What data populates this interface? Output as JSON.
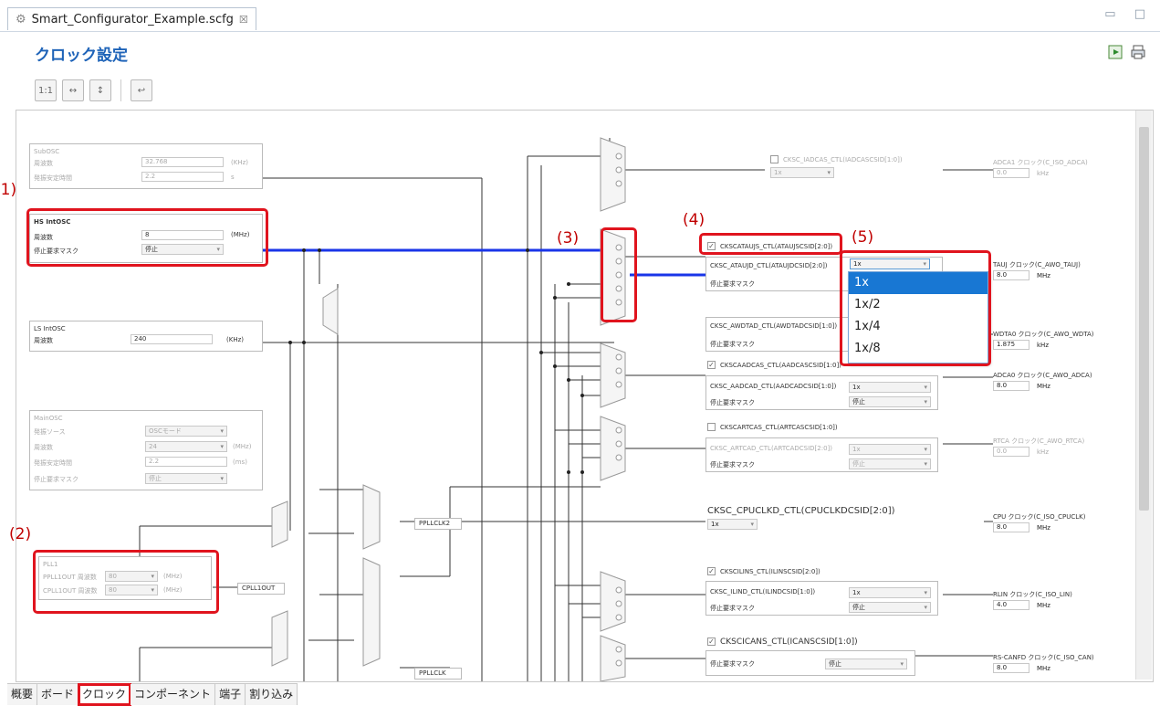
{
  "editor_tab": {
    "title": "Smart_Configurator_Example.scfg",
    "close": "☒"
  },
  "window_controls": "▭ □",
  "page_title": "クロック設定",
  "annotations": [
    "(1)",
    "(2)",
    "(3)",
    "(4)",
    "(5)"
  ],
  "subosc": {
    "title": "SubOSC",
    "freq_label": "周波数",
    "freq_value": "32.768",
    "freq_unit": "(KHz)",
    "stab_label": "発振安定時間",
    "stab_value": "2.2",
    "stab_unit": "s"
  },
  "hs_intosc": {
    "title": "HS IntOSC",
    "freq_label": "周波数",
    "freq_value": "8",
    "freq_unit": "(MHz)",
    "mask_label": "停止要求マスク",
    "mask_value": "停止"
  },
  "ls_intosc": {
    "title": "LS IntOSC",
    "freq_label": "周波数",
    "freq_value": "240",
    "freq_unit": "(KHz)"
  },
  "mainosc": {
    "title": "MainOSC",
    "src_label": "発振ソース",
    "src_value": "OSCモード",
    "freq_label": "周波数",
    "freq_value": "24",
    "freq_unit": "(MHz)",
    "stab_label": "発振安定時間",
    "stab_value": "2.2",
    "stab_unit": "(ms)",
    "mask_label": "停止要求マスク",
    "mask_value": "停止"
  },
  "pll1": {
    "title": "PLL1",
    "out_label": "PPLL1OUT 周波数",
    "out_value": "80",
    "out_unit": "(MHz)",
    "cout_label": "CPLL1OUT 周波数",
    "cout_value": "80",
    "cout_unit": "(MHz)"
  },
  "signals": {
    "cpll1out": "CPLL1OUT",
    "ppllclk2": "PPLLCLK2",
    "ppllclk": "PPLLCLK"
  },
  "adca1": {
    "cb": "CKSC_IADCAS_CTL(IADCASCSID[1:0])",
    "sel": "1x",
    "out_label": "ADCA1 クロック(C_ISO_ADCA)",
    "out_value": "0.0",
    "unit": "kHz"
  },
  "atauj": {
    "cb": "CKSCATAUJS_CTL(ATAUJSCSID[2:0])",
    "div_label": "CKSC_ATAUJD_CTL(ATAUJDCSID[2:0])",
    "div_value": "1x",
    "mask_label": "停止要求マスク",
    "out_label": "TAUJ クロック(C_AWO_TAUJ)",
    "out_value": "8.0",
    "unit": "MHz"
  },
  "dropdown": {
    "options": [
      "1x",
      "1x/2",
      "1x/4",
      "1x/8"
    ]
  },
  "awdta": {
    "div_label": "CKSC_AWDTAD_CTL(AWDTADCSID[1:0])",
    "mask_label": "停止要求マスク",
    "out_label": "WDTA0 クロック(C_AWO_WDTA)",
    "out_value": "1.875",
    "unit": "kHz"
  },
  "aadca": {
    "cb": "CKSCAADCAS_CTL(AADCASCSID[1:0])",
    "div_label": "CKSC_AADCAD_CTL(AADCADCSID[1:0])",
    "div_value": "1x",
    "mask_label": "停止要求マスク",
    "mask_value": "停止",
    "out_label": "ADCA0 クロック(C_AWO_ADCA)",
    "out_value": "8.0",
    "unit": "MHz"
  },
  "artca": {
    "cb": "CKSCARTCAS_CTL(ARTCASCSID[1:0])",
    "div_label": "CKSC_ARTCAD_CTL(ARTCADCSID[2:0])",
    "div_value": "1x",
    "mask_label": "停止要求マスク",
    "mask_value": "停止",
    "out_label": "RTCA クロック(C_AWO_RTCA)",
    "out_value": "0.0",
    "unit": "kHz"
  },
  "cpu": {
    "label": "CKSC_CPUCLKD_CTL(CPUCLKDCSID[2:0])",
    "sel": "1x",
    "out_label": "CPU クロック(C_ISO_CPUCLK)",
    "out_value": "8.0",
    "unit": "MHz"
  },
  "ilin": {
    "cb": "CKSCILINS_CTL(ILINSCSID[2:0])",
    "div_label": "CKSC_ILIND_CTL(ILINDCSID[1:0])",
    "div_value": "1x",
    "mask_label": "停止要求マスク",
    "mask_value": "停止",
    "out_label": "RLIN クロック(C_ISO_LIN)",
    "out_value": "4.0",
    "unit": "MHz"
  },
  "ican": {
    "cb": "CKSCICANS_CTL(ICANSCSID[1:0])",
    "mask_label": "停止要求マスク",
    "mask_value": "停止",
    "out_label": "RS-CANFD クロック(C_ISO_CAN)",
    "out_value": "8.0",
    "unit": "MHz"
  },
  "bottom_tabs": [
    "概要",
    "ボード",
    "クロック",
    "コンポーネント",
    "端子",
    "割り込み"
  ]
}
